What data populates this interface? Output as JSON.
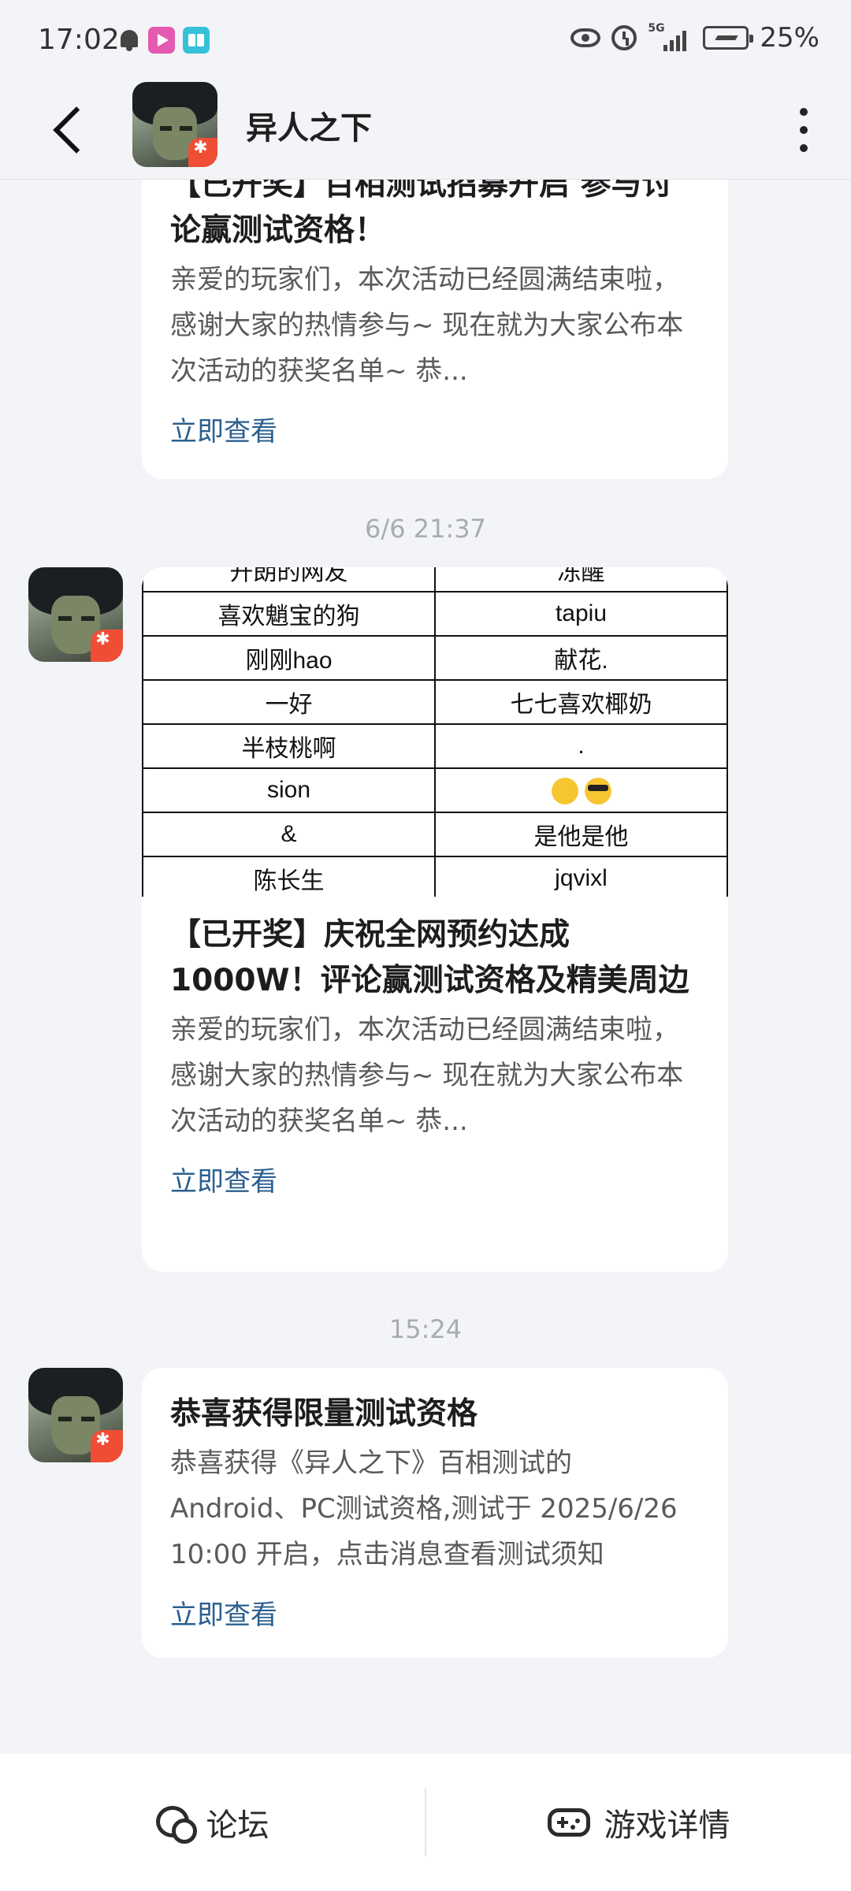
{
  "status_bar": {
    "time": "17:02",
    "network": "5G",
    "battery": "25%"
  },
  "header": {
    "title": "异人之下"
  },
  "messages": [
    {
      "title": "【已开奖】百相测试招募开启 参与讨论赢测试资格！",
      "desc": "亲爱的玩家们，本次活动已经圆满结束啦，感谢大家的热情参与~ 现在就为大家公布本次活动的获奖名单~ 恭...",
      "link": "立即查看"
    },
    {
      "time": "6/6  21:37",
      "table_rows": [
        [
          "开朗的网友",
          "冻醒"
        ],
        [
          "喜欢魈宝的狗",
          "tapiu"
        ],
        [
          "刚刚hao",
          "献花."
        ],
        [
          "一好",
          "七七喜欢椰奶"
        ],
        [
          "半枝桃啊",
          "."
        ],
        [
          "sion",
          ""
        ],
        [
          "&",
          "是他是他"
        ],
        [
          "陈长生",
          "jqvixl"
        ]
      ],
      "title": "【已开奖】庆祝全网预约达成1000W！评论赢测试资格及精美周边",
      "desc": "亲爱的玩家们，本次活动已经圆满结束啦，感谢大家的热情参与~ 现在就为大家公布本次活动的获奖名单~ 恭...",
      "link": "立即查看"
    },
    {
      "time": "15:24",
      "title": "恭喜获得限量测试资格",
      "desc": "恭喜获得《异人之下》百相测试的Android、PC测试资格,测试于 2025/6/26 10:00 开启，点击消息查看测试须知",
      "link": "立即查看"
    }
  ],
  "bottom_bar": {
    "forum": "论坛",
    "game_detail": "游戏详情"
  }
}
